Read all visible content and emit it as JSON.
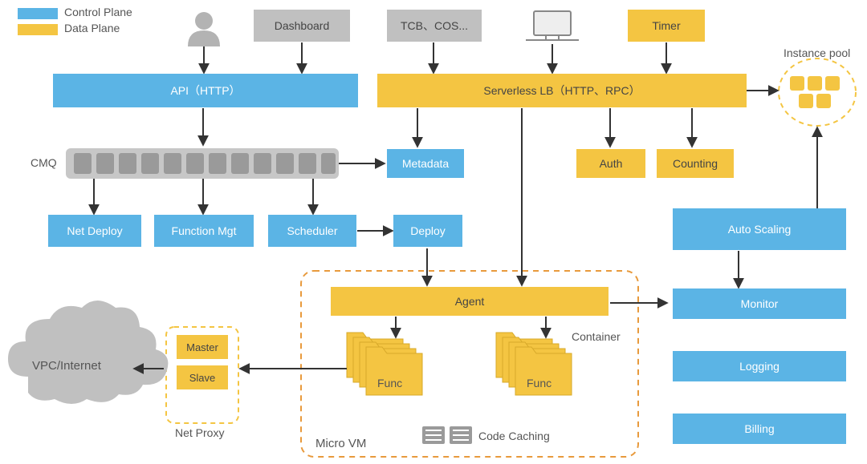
{
  "legend": {
    "control": "Control Plane",
    "data": "Data Plane"
  },
  "labels": {
    "cmq": "CMQ",
    "instancePool": "Instance pool",
    "netProxy": "Net Proxy",
    "microVm": "Micro VM",
    "codeCaching": "Code Caching",
    "container": "Container",
    "vpc": "VPC/Internet"
  },
  "nodes": {
    "dashboard": "Dashboard",
    "tcb": "TCB、COS...",
    "timer": "Timer",
    "api": "API（HTTP）",
    "slb": "Serverless LB（HTTP、RPC）",
    "metadata": "Metadata",
    "auth": "Auth",
    "counting": "Counting",
    "netDeploy": "Net Deploy",
    "functionMgt": "Function Mgt",
    "scheduler": "Scheduler",
    "deploy": "Deploy",
    "autoScaling": "Auto Scaling",
    "agent": "Agent",
    "master": "Master",
    "slave": "Slave",
    "func1": "Func",
    "func2": "Func",
    "monitor": "Monitor",
    "logging": "Logging",
    "billing": "Billing"
  },
  "colors": {
    "blue": "#5bb4e5",
    "yellow": "#f4c542",
    "grey": "#c0c0c0",
    "dashOrange": "#e89a3c"
  }
}
